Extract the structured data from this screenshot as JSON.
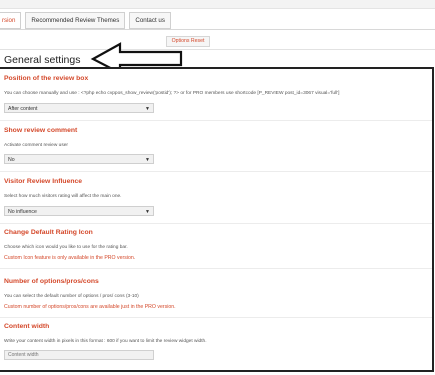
{
  "tabs": [
    {
      "label": "rsion",
      "active": true
    },
    {
      "label": "Recommended Review Themes",
      "active": false
    },
    {
      "label": "Contact us",
      "active": false
    }
  ],
  "options_reset_label": "Options Reset",
  "page_title": "General settings",
  "sections": [
    {
      "title": "Position of the review box",
      "description": "You can choose manually and use : <?php echo cvppos_show_review('postid'); ?> or for PRO members use shortcode [P_REVIEW post_id=3067 visual='full']",
      "select_value": "After content"
    },
    {
      "title": "Show review comment",
      "description": "Activate comment review user",
      "select_value": "No"
    },
    {
      "title": "Visitor Review Influence",
      "description": "Select how much visitors rating will affect the main one.",
      "select_value": "No influence"
    },
    {
      "title": "Change Default Rating Icon",
      "description": "Choose which icon would you like to use for the rating bar.",
      "note": "Custom Icon feature is only available in the PRO version."
    },
    {
      "title": "Number of options/pros/cons",
      "description": "You can select the default number of options / pros/ cons (3-10)",
      "note": "Custom number of options/pros/cons are available just in the PRO version."
    },
    {
      "title": "Content width",
      "description": "Write your content width in pixels in this format : 600 if you want to limit the review widget width.",
      "input_placeholder": "Content width"
    }
  ],
  "colors": {
    "accent": "#d4482a",
    "panel_border": "#222222"
  }
}
